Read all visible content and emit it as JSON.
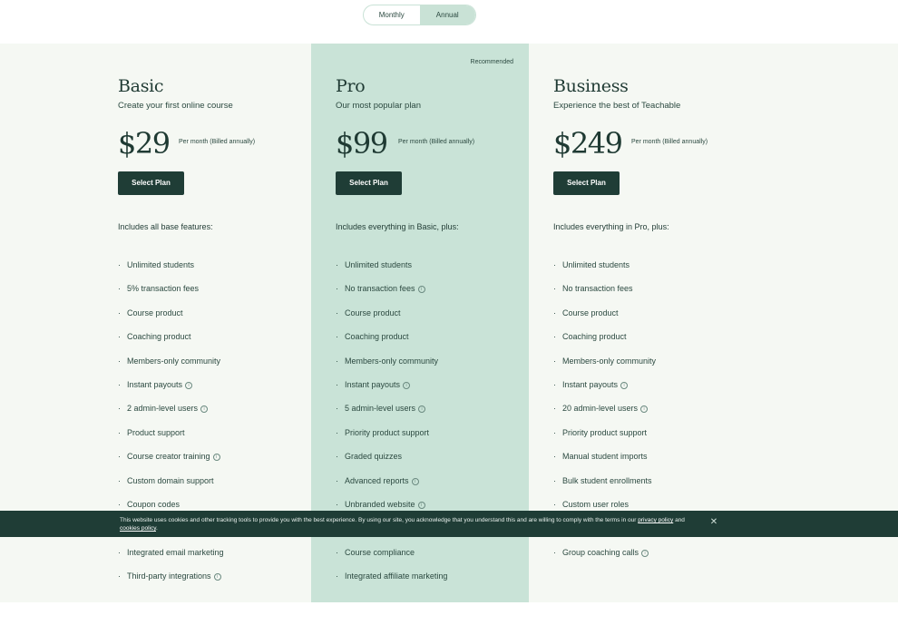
{
  "billing_toggle": {
    "monthly": "Monthly",
    "annual": "Annual",
    "selected": "Annual"
  },
  "plans": [
    {
      "name": "Basic",
      "tagline": "Create your first online course",
      "price": "$29",
      "price_note": "Per month (Billed annually)",
      "button": "Select Plan",
      "includes": "Includes all base features:",
      "features": [
        {
          "text": "Unlimited students",
          "info": false
        },
        {
          "text": "5% transaction fees",
          "info": false
        },
        {
          "text": "Course product",
          "info": false
        },
        {
          "text": "Coaching product",
          "info": false
        },
        {
          "text": "Members-only community",
          "info": false
        },
        {
          "text": "Instant payouts",
          "info": true
        },
        {
          "text": "2 admin-level users",
          "info": true
        },
        {
          "text": "Product support",
          "info": false
        },
        {
          "text": "Course creator training",
          "info": true
        },
        {
          "text": "Custom domain support",
          "info": false
        },
        {
          "text": "Coupon codes",
          "info": false
        },
        {
          "text": "",
          "info": false
        },
        {
          "text": "Integrated email marketing",
          "info": false
        },
        {
          "text": "Third-party integrations",
          "info": true
        }
      ]
    },
    {
      "name": "Pro",
      "recommended": "Recommended",
      "tagline": "Our most popular plan",
      "price": "$99",
      "price_note": "Per month (Billed annually)",
      "button": "Select Plan",
      "includes": "Includes everything in Basic, plus:",
      "features": [
        {
          "text": "Unlimited students",
          "info": false
        },
        {
          "text": "No transaction fees",
          "info": true
        },
        {
          "text": "Course product",
          "info": false
        },
        {
          "text": "Coaching product",
          "info": false
        },
        {
          "text": "Members-only community",
          "info": false
        },
        {
          "text": "Instant payouts",
          "info": true
        },
        {
          "text": "5 admin-level users",
          "info": true
        },
        {
          "text": "Priority product support",
          "info": false
        },
        {
          "text": "Graded quizzes",
          "info": false
        },
        {
          "text": "Advanced reports",
          "info": true
        },
        {
          "text": "Unbranded website",
          "info": true
        },
        {
          "text": "",
          "info": false
        },
        {
          "text": "Course compliance",
          "info": false
        },
        {
          "text": "Integrated affiliate marketing",
          "info": false
        }
      ]
    },
    {
      "name": "Business",
      "tagline": "Experience the best of Teachable",
      "price": "$249",
      "price_note": "Per month (Billed annually)",
      "button": "Select Plan",
      "includes": "Includes everything in Pro, plus:",
      "features": [
        {
          "text": "Unlimited students",
          "info": false
        },
        {
          "text": "No transaction fees",
          "info": false
        },
        {
          "text": "Course product",
          "info": false
        },
        {
          "text": "Coaching product",
          "info": false
        },
        {
          "text": "Members-only community",
          "info": false
        },
        {
          "text": "Instant payouts",
          "info": true
        },
        {
          "text": "20 admin-level users",
          "info": true
        },
        {
          "text": "Priority product support",
          "info": false
        },
        {
          "text": "Manual student imports",
          "info": false
        },
        {
          "text": "Bulk student enrollments",
          "info": false
        },
        {
          "text": "Custom user roles",
          "info": false
        },
        {
          "text": "",
          "info": false
        },
        {
          "text": "Group coaching calls",
          "info": true
        }
      ]
    }
  ],
  "cookie_banner": {
    "text": "This website uses cookies and other tracking tools to provide you with the best experience. By using our site, you acknowledge that you understand this and are willing to comply with the terms in our",
    "privacy_link": "privacy policy",
    "and": "and",
    "cookies_link": "cookies policy",
    "end": ".",
    "close": "✕"
  },
  "colors": {
    "accent": "#c9e3d7",
    "dark": "#1f3d36",
    "background": "#f5f8f3"
  }
}
